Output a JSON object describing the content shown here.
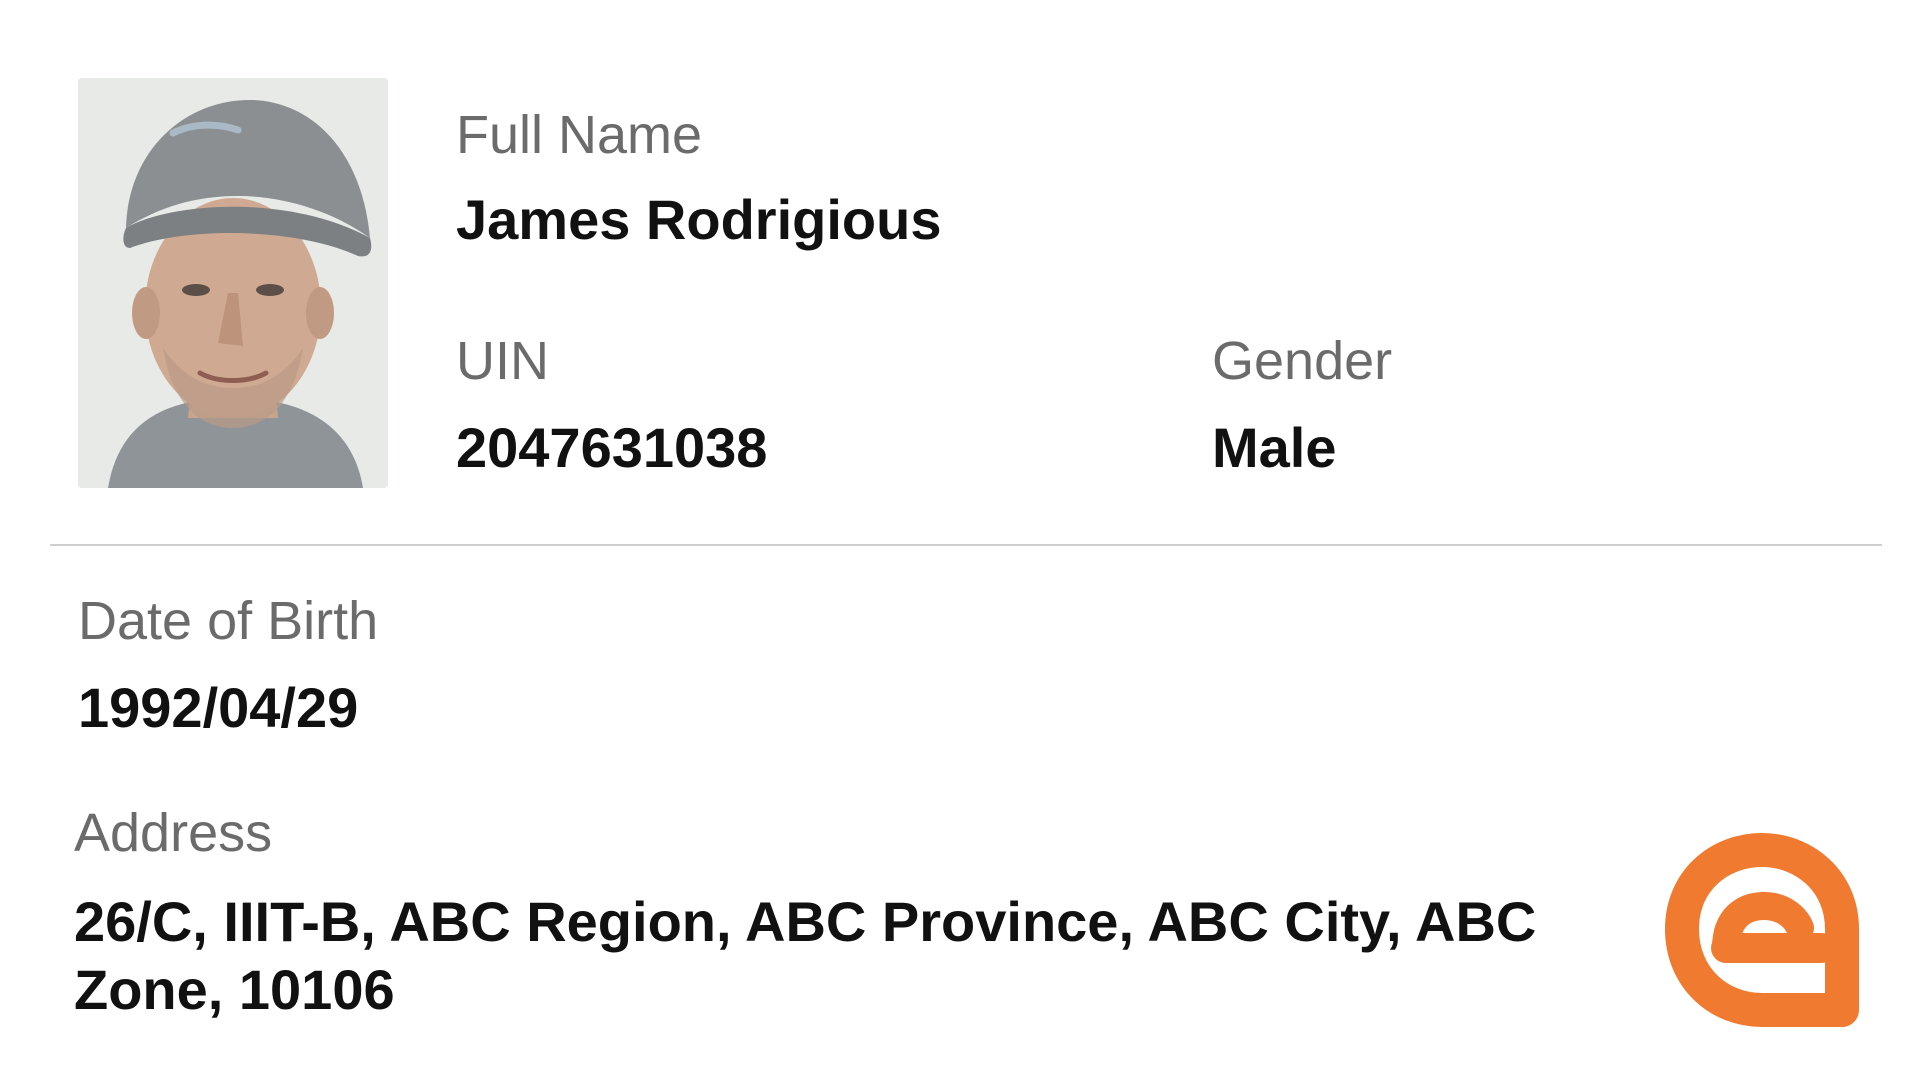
{
  "card": {
    "fields": {
      "full_name": {
        "label": "Full Name",
        "value": "James Rodrigious"
      },
      "uin": {
        "label": "UIN",
        "value": "2047631038"
      },
      "gender": {
        "label": "Gender",
        "value": "Male"
      },
      "date_of_birth": {
        "label": "Date of Birth",
        "value": "1992/04/29"
      },
      "address": {
        "label": "Address",
        "value": "26/C, IIIT-B, ABC Region, ABC Province, ABC City, ABC Zone, 10106"
      }
    },
    "photo": {
      "icon": "portrait-photo"
    },
    "logo": {
      "icon": "brand-logo-icon",
      "color": "#F07A30"
    }
  },
  "colors": {
    "label": "#6b6b6b",
    "value": "#111111",
    "divider": "#cfcfcf",
    "accent": "#F07A30"
  }
}
